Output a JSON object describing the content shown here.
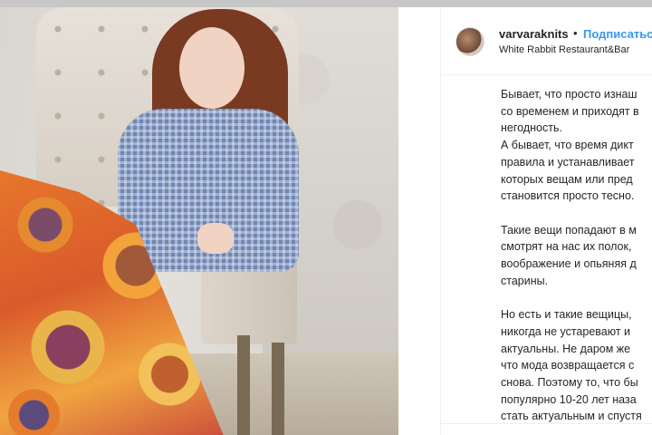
{
  "post": {
    "username": "varvaraknits",
    "separator": "•",
    "follow_label": "Подписаться",
    "location": "White Rabbit Restaurant&Bar"
  },
  "caption_lines": [
    "Бывает, что просто изнаш",
    "со временем и приходят в",
    "негодность.",
    "А бывает, что время дикт",
    "правила и устанавливает",
    "которых вещам или пред",
    "становится просто тесно.",
    "",
    "Такие вещи попадают в м",
    "смотрят на нас их полок,",
    "воображение и опьяняя д",
    "старины.",
    "",
    "Но есть и такие вещицы,",
    "никогда не устаревают и",
    "актуальны. Не даром же",
    "что мода возвращается с",
    "снова. Поэтому то, что бы",
    "популярно 10-20 лет наза",
    "стать актуальным и спустя"
  ],
  "photo": {
    "alt": "",
    "palette": {
      "blanket": "#e7772b",
      "dress": "#6f87b5",
      "hair": "#7a3a22",
      "chair": "#e7e1d9"
    }
  },
  "colors": {
    "link": "#3897f0",
    "text": "#262626",
    "border": "#efefef"
  }
}
